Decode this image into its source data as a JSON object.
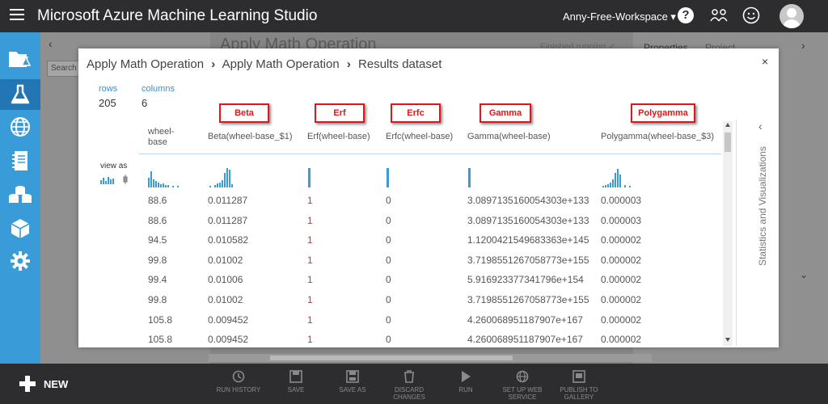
{
  "app": {
    "title": "Microsoft Azure Machine Learning Studio",
    "workspace": "Anny-Free-Workspace ▾",
    "help_glyph": "?"
  },
  "background": {
    "experiment_title": "Apply Math Operation",
    "status": "Finished running ✓",
    "tabs": [
      "Properties",
      "Project"
    ],
    "search_placeholder": "Search"
  },
  "modal": {
    "breadcrumb": [
      "Apply Math Operation",
      "Apply Math Operation",
      "Results dataset"
    ],
    "separator": "›",
    "close_glyph": "×",
    "rows_label": "rows",
    "rows_value": "205",
    "columns_label": "columns",
    "columns_value": "6",
    "view_as_label": "view as",
    "side_panel_label": "Statistics and Visualizations",
    "side_panel_chevron": "‹",
    "highlight_labels": [
      "Beta",
      "Erf",
      "Erfc",
      "Gamma",
      "Polygamma"
    ],
    "columns": [
      "wheel-base",
      "Beta(wheel-base_$1)",
      "Erf(wheel-base)",
      "Erfc(wheel-base)",
      "Gamma(wheel-base)",
      "Polygamma(wheel-base_$3)"
    ],
    "rows": [
      [
        "88.6",
        "0.011287",
        "1",
        "0",
        "3.0897135160054303e+133",
        "0.000003"
      ],
      [
        "88.6",
        "0.011287",
        "1",
        "0",
        "3.0897135160054303e+133",
        "0.000003"
      ],
      [
        "94.5",
        "0.010582",
        "1",
        "0",
        "1.1200421549683363e+145",
        "0.000002"
      ],
      [
        "99.8",
        "0.01002",
        "1",
        "0",
        "3.7198551267058773e+155",
        "0.000002"
      ],
      [
        "99.4",
        "0.01006",
        "1",
        "0",
        "5.916923377341796e+154",
        "0.000002"
      ],
      [
        "99.8",
        "0.01002",
        "1",
        "0",
        "3.7198551267058773e+155",
        "0.000002"
      ],
      [
        "105.8",
        "0.009452",
        "1",
        "0",
        "4.260068951187907e+167",
        "0.000002"
      ],
      [
        "105.8",
        "0.009452",
        "1",
        "0",
        "4.260068951187907e+167",
        "0.000002"
      ]
    ]
  },
  "bottom": {
    "new_label": "NEW",
    "commands": [
      "RUN HISTORY",
      "SAVE",
      "SAVE AS",
      "DISCARD CHANGES",
      "RUN",
      "SET UP WEB SERVICE",
      "PUBLISH TO GALLERY"
    ]
  },
  "colors": {
    "accent": "#3a9bd9",
    "highlight": "#e3141b",
    "topbar": "#2d2d30"
  }
}
